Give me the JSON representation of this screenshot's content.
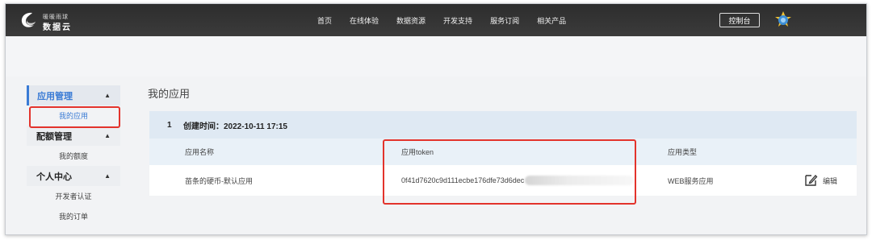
{
  "logo": {
    "line1": "暖暖雨球",
    "line2": "数据云"
  },
  "nav": {
    "items": [
      "首页",
      "在线体验",
      "数据资源",
      "开发支持",
      "服务订阅",
      "相关产品"
    ]
  },
  "topbar": {
    "console_label": "控制台"
  },
  "sidebar": {
    "groups": [
      {
        "label": "应用管理",
        "items": [
          "我的应用"
        ]
      },
      {
        "label": "配额管理",
        "items": [
          "我的额度"
        ]
      },
      {
        "label": "个人中心",
        "items": [
          "开发者认证",
          "我的订单"
        ]
      }
    ]
  },
  "main": {
    "title": "我的应用",
    "app": {
      "index": "1",
      "created_label": "创建时间：2022-10-11 17:15"
    },
    "columns": [
      "应用名称",
      "应用token",
      "应用类型"
    ],
    "rows": [
      {
        "name": "苗条的硬币-默认应用",
        "token": "0f41d7620c9d111ecbe176dfe73d6dec",
        "type": "WEB服务应用",
        "action": "编辑"
      }
    ]
  },
  "colors": {
    "accent": "#3a7bd5",
    "highlight": "#e3332c",
    "topbar": "#333333"
  }
}
